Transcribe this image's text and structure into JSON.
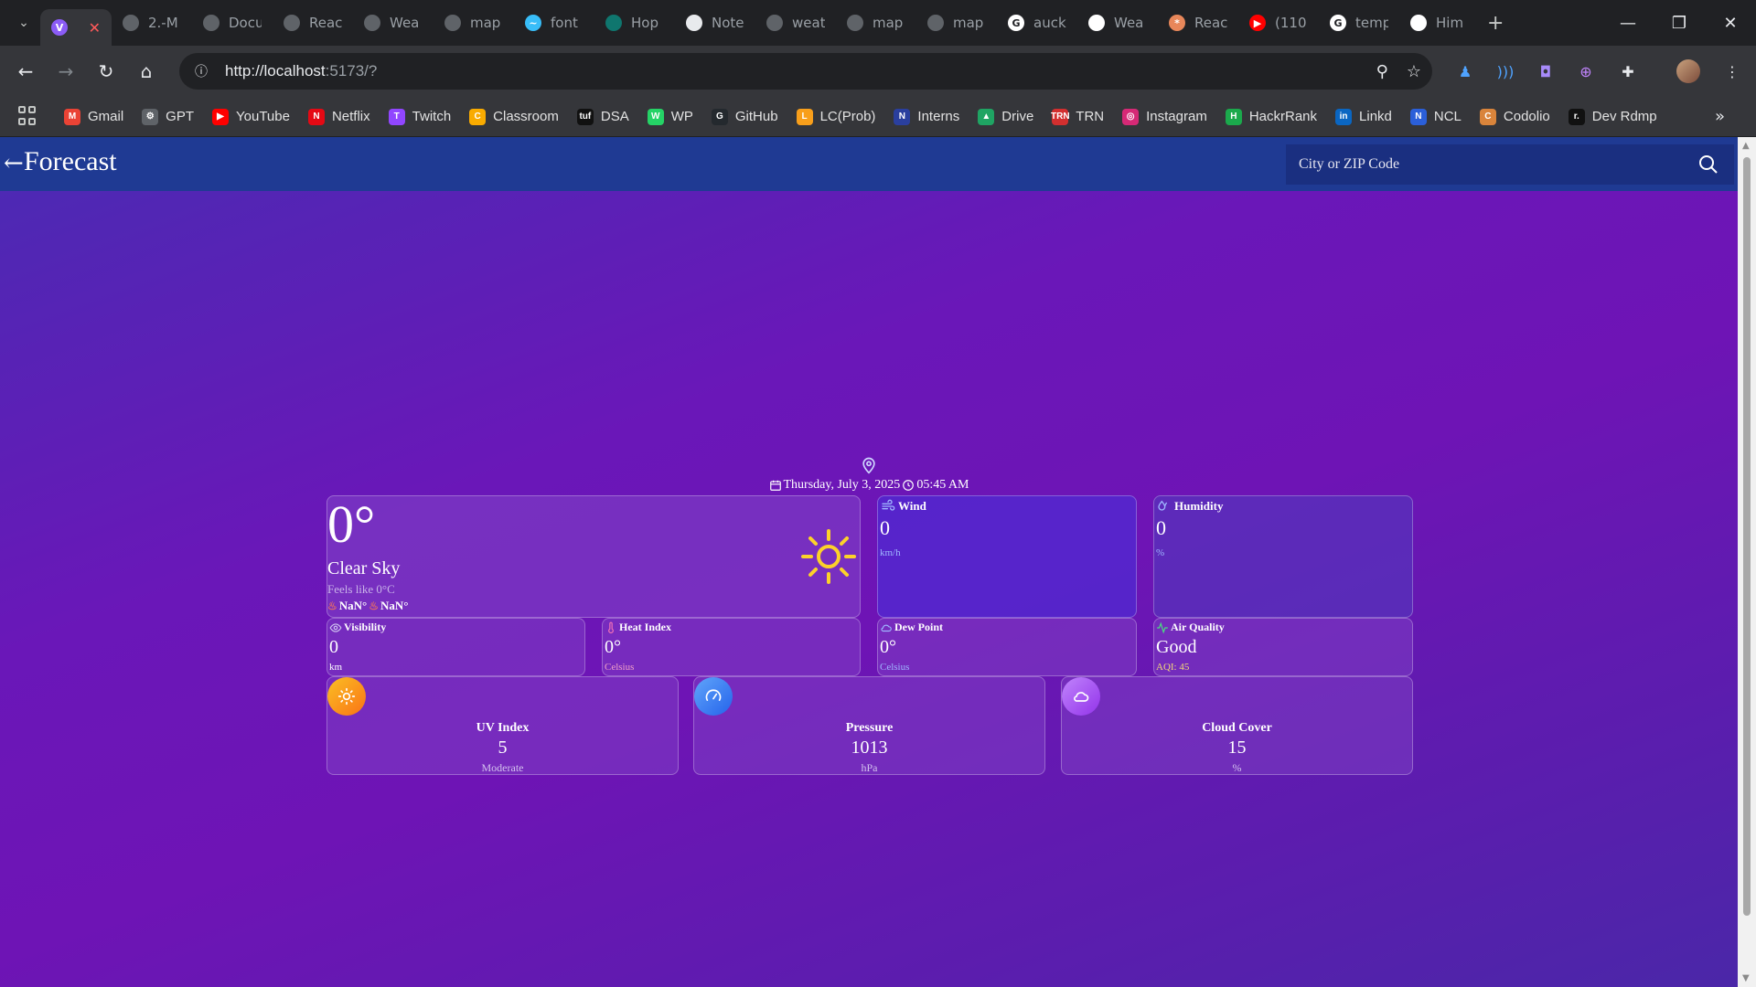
{
  "browser": {
    "tabs": [
      {
        "title": "",
        "color": "#8b5cf6",
        "glyph": "V",
        "active": true
      },
      {
        "title": "2.-M",
        "color": "#5f6368",
        "glyph": ""
      },
      {
        "title": "Docu",
        "color": "#5f6368",
        "glyph": ""
      },
      {
        "title": "Reac",
        "color": "#5f6368",
        "glyph": ""
      },
      {
        "title": "Wea",
        "color": "#5f6368",
        "glyph": ""
      },
      {
        "title": "map",
        "color": "#5f6368",
        "glyph": ""
      },
      {
        "title": "font",
        "color": "#38bdf8",
        "glyph": "~"
      },
      {
        "title": "Hop",
        "color": "#0f766e",
        "glyph": ""
      },
      {
        "title": "Note",
        "color": "#e8eaed",
        "glyph": ""
      },
      {
        "title": "weat",
        "color": "#5f6368",
        "glyph": ""
      },
      {
        "title": "map",
        "color": "#5f6368",
        "glyph": ""
      },
      {
        "title": "map",
        "color": "#5f6368",
        "glyph": ""
      },
      {
        "title": "auck",
        "color": "#ffffff",
        "glyph": "G"
      },
      {
        "title": "Wea",
        "color": "#ffffff",
        "glyph": ""
      },
      {
        "title": "Reac",
        "color": "#e8875a",
        "glyph": "*"
      },
      {
        "title": "(110",
        "color": "#ff0000",
        "glyph": "▶"
      },
      {
        "title": "temp",
        "color": "#ffffff",
        "glyph": "G"
      },
      {
        "title": "Him",
        "color": "#ffffff",
        "glyph": ""
      }
    ],
    "url_host": "http://localhost",
    "url_rest": ":5173/?",
    "bookmarks": [
      {
        "label": "Gmail",
        "color": "#ea4335",
        "glyph": "M"
      },
      {
        "label": "GPT",
        "color": "#5f6368",
        "glyph": "⚙"
      },
      {
        "label": "YouTube",
        "color": "#ff0000",
        "glyph": "▶"
      },
      {
        "label": "Netflix",
        "color": "#e50914",
        "glyph": "N"
      },
      {
        "label": "Twitch",
        "color": "#9146ff",
        "glyph": "T"
      },
      {
        "label": "Classroom",
        "color": "#f9ab00",
        "glyph": "C"
      },
      {
        "label": "DSA",
        "color": "#111111",
        "glyph": "tuf"
      },
      {
        "label": "WP",
        "color": "#25d366",
        "glyph": "W"
      },
      {
        "label": "GitHub",
        "color": "#24292e",
        "glyph": "G"
      },
      {
        "label": "LC(Prob)",
        "color": "#f89f1b",
        "glyph": "L"
      },
      {
        "label": "Interns",
        "color": "#2a3f9e",
        "glyph": "N"
      },
      {
        "label": "Drive",
        "color": "#1fa463",
        "glyph": "▲"
      },
      {
        "label": "TRN",
        "color": "#d32f2f",
        "glyph": "TRN"
      },
      {
        "label": "Instagram",
        "color": "#d62976",
        "glyph": "◎"
      },
      {
        "label": "HackrRank",
        "color": "#1ba94c",
        "glyph": "H"
      },
      {
        "label": "Linkd",
        "color": "#0a66c2",
        "glyph": "in"
      },
      {
        "label": "NCL",
        "color": "#2b5fd9",
        "glyph": "N"
      },
      {
        "label": "Codolio",
        "color": "#d9843b",
        "glyph": "C"
      },
      {
        "label": "Dev Rdmp",
        "color": "#111111",
        "glyph": "r."
      }
    ]
  },
  "app": {
    "brand": "Forecast",
    "search_placeholder": "City or ZIP Code",
    "date": "Thursday, July 3, 2025",
    "time": "05:45 AM"
  },
  "current": {
    "temp": "0°",
    "condition": "Clear Sky",
    "feels_like": "Feels like 0°C",
    "min": "NaN°",
    "max": "NaN°"
  },
  "stats": {
    "wind": {
      "label": "Wind",
      "value": "0",
      "unit": "km/h"
    },
    "humidity": {
      "label": "Humidity",
      "value": "0",
      "unit": "%"
    },
    "visibility": {
      "label": "Visibility",
      "value": "0",
      "unit": "km"
    },
    "heat_index": {
      "label": "Heat Index",
      "value": "0°",
      "unit": "Celsius"
    },
    "dew_point": {
      "label": "Dew Point",
      "value": "0°",
      "unit": "Celsius"
    },
    "air_quality": {
      "label": "Air Quality",
      "value": "Good",
      "unit": "AQI: 45"
    }
  },
  "details": {
    "uv": {
      "label": "UV Index",
      "value": "5",
      "sub": "Moderate",
      "color": "#f59e0b"
    },
    "pressure": {
      "label": "Pressure",
      "value": "1013",
      "sub": "hPa",
      "color": "#3b82f6"
    },
    "cloud": {
      "label": "Cloud Cover",
      "value": "15",
      "sub": "%",
      "color": "#a855f7"
    }
  }
}
